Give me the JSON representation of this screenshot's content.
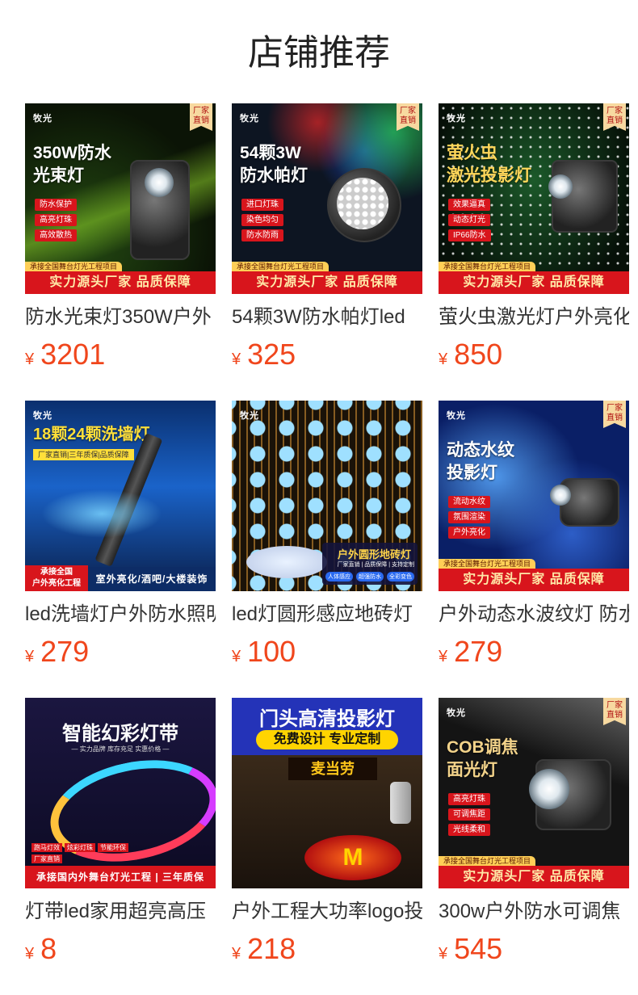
{
  "shop": {
    "title": "店铺推荐"
  },
  "products": [
    {
      "name": "防水光束灯350W户外",
      "currency": "¥",
      "price": "3201",
      "thumb": {
        "brand": "牧光",
        "corner": "厂家\n直销",
        "headline": "350W防水\n光束灯",
        "features": [
          "防水保护",
          "高亮灯珠",
          "高效散热"
        ],
        "subband": "承接全国舞台灯光工程项目",
        "band": "实力源头厂家 品质保障",
        "accent": "#8ed12a"
      }
    },
    {
      "name": "54颗3W防水帕灯led",
      "currency": "¥",
      "price": "325",
      "thumb": {
        "brand": "牧光",
        "corner": "厂家\n直销",
        "headline": "54颗3W\n防水帕灯",
        "features": [
          "进口灯珠",
          "染色均匀",
          "防水防雨"
        ],
        "subband": "承接全国舞台灯光工程项目",
        "band": "实力源头厂家 品质保障",
        "accent": "#2ad45a"
      }
    },
    {
      "name": "萤火虫激光灯户外亮化",
      "currency": "¥",
      "price": "850",
      "thumb": {
        "brand": "牧光",
        "corner": "厂家\n直销",
        "headline": "萤火虫\n激光投影灯",
        "features": [
          "效果逼真",
          "动态灯光",
          "IP66防水"
        ],
        "subband": "承接全国舞台灯光工程项目",
        "band": "实力源头厂家 品质保障",
        "accent": "#1c7a3a"
      }
    },
    {
      "name": "led洗墙灯户外防水照明",
      "currency": "¥",
      "price": "279",
      "thumb": {
        "brand": "牧光",
        "headline": "18颗24颗洗墙灯",
        "tagline": "厂家直销|三年质保|品质保障",
        "badge": "承接全国\n户外亮化工程",
        "band": "室外亮化/酒吧/大楼装饰",
        "accent": "#3ab8ff"
      }
    },
    {
      "name": "led灯圆形感应地砖灯",
      "currency": "¥",
      "price": "100",
      "thumb": {
        "brand": "牧光",
        "headline": "户外圆形地砖灯",
        "tagline": "厂家直销 | 品质保障 | 支持定制",
        "pills": [
          "人体感应",
          "超强防水",
          "全彩变色"
        ],
        "accent": "#f1a63a"
      }
    },
    {
      "name": "户外动态水波纹灯 防水",
      "currency": "¥",
      "price": "279",
      "thumb": {
        "brand": "牧光",
        "corner": "厂家\n直销",
        "headline": "动态水纹\n投影灯",
        "features": [
          "流动水纹",
          "氛围渲染",
          "户外亮化"
        ],
        "subband": "承接全国舞台灯光工程项目",
        "band": "实力源头厂家 品质保障",
        "accent": "#1f6fe8"
      }
    },
    {
      "name": "灯带led家用超亮高压",
      "currency": "¥",
      "price": "8",
      "thumb": {
        "headline": "智能幻彩灯带",
        "tagline": "— 实力品牌 库存充足 实惠价格 —",
        "features": [
          "跑马灯效",
          "炫彩灯珠",
          "节能环保",
          "厂家直销"
        ],
        "band": "承接国内外舞台灯光工程 | 三年质保",
        "accent": "#d63cff"
      }
    },
    {
      "name": "户外工程大功率logo投影",
      "currency": "¥",
      "price": "218",
      "thumb": {
        "headline": "门头高清投影灯",
        "tagline": "免费设计 专业定制",
        "sign": "麦当劳",
        "logo": "M",
        "accent": "#ffd400"
      }
    },
    {
      "name": "300w户外防水可调焦",
      "currency": "¥",
      "price": "545",
      "thumb": {
        "brand": "牧光",
        "corner": "厂家\n直销",
        "headline": "COB调焦\n面光灯",
        "features": [
          "高亮灯珠",
          "可调焦距",
          "光线柔和"
        ],
        "subband": "承接全国舞台灯光工程项目",
        "band": "实力源头厂家 品质保障",
        "accent": "#dddddd"
      }
    }
  ]
}
